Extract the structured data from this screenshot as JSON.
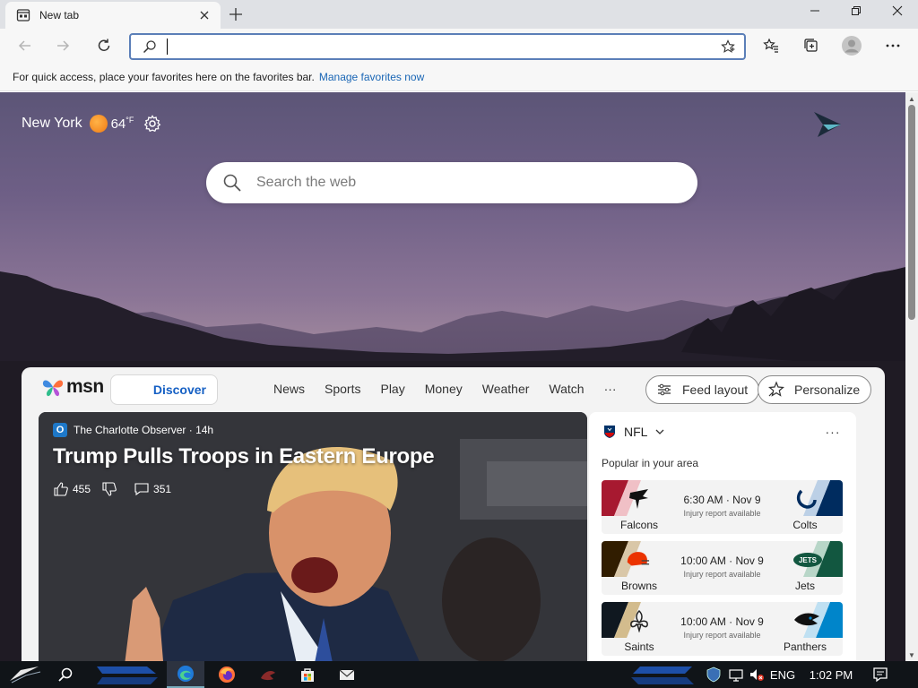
{
  "browser": {
    "tab_title": "New tab",
    "address_value": "",
    "window_controls": [
      "minimize-icon",
      "restore-icon",
      "close-icon"
    ]
  },
  "favorites_bar": {
    "message": "For quick access, place your favorites here on the favorites bar.",
    "link": "Manage favorites now"
  },
  "weather": {
    "city": "New York",
    "temperature": "64",
    "unit": "°F"
  },
  "web_search": {
    "placeholder": "Search the web"
  },
  "msn": {
    "brand": "msn",
    "discover": "Discover",
    "nav": [
      "News",
      "Sports",
      "Play",
      "Money",
      "Weather",
      "Watch",
      "···"
    ],
    "feed_layout": "Feed layout",
    "personalize": "Personalize"
  },
  "hero": {
    "source": "The Charlotte Observer",
    "age": "14h",
    "headline": "Trump Pulls Troops in Eastern Europe",
    "likes": "455",
    "comments": "351"
  },
  "nfl": {
    "league": "NFL",
    "more": "···",
    "subtitle": "Popular in your area",
    "games": [
      {
        "home": "Falcons",
        "away": "Colts",
        "time": "6:30 AM · Nov 9",
        "note": "Injury report available",
        "home_color": "#a71930",
        "away_color": "#002c5f"
      },
      {
        "home": "Browns",
        "away": "Jets",
        "time": "10:00 AM · Nov 9",
        "note": "Injury report available",
        "home_color": "#311d00",
        "away_color": "#125740"
      },
      {
        "home": "Saints",
        "away": "Panthers",
        "time": "10:00 AM · Nov 9",
        "note": "Injury report available",
        "home_color": "#101820",
        "away_color": "#0085ca"
      }
    ]
  },
  "taskbar": {
    "language": "ENG",
    "clock": "1:02 PM"
  },
  "colors": {
    "accent": "#1660c4",
    "link": "#1a66b5",
    "address_border": "#5b7fb8"
  }
}
